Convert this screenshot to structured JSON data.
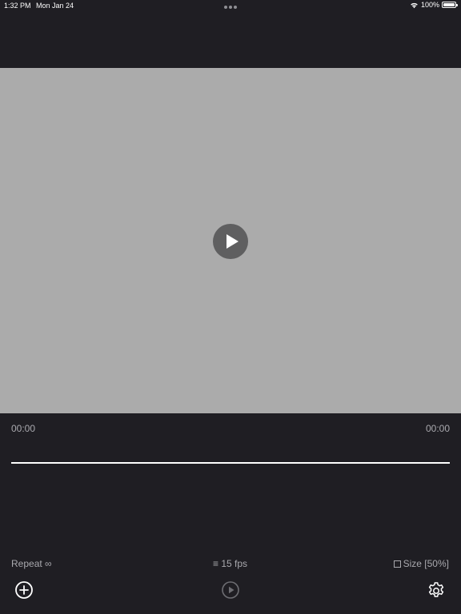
{
  "status_bar": {
    "time": "1:32 PM",
    "date": "Mon Jan 24",
    "battery": "100%",
    "icons": [
      "wifi-icon",
      "battery-icon",
      "multitask-dots-icon"
    ]
  },
  "preview": {
    "icon": "play-icon",
    "colors": {
      "canvas": "#ababab",
      "button": "#5f5f60"
    }
  },
  "timeline": {
    "start_time": "00:00",
    "end_time": "00:00"
  },
  "options": {
    "repeat": "Repeat ∞",
    "fps": "≡ 15 fps",
    "size": "Size [50%]",
    "size_checked": false
  },
  "toolbar": {
    "icons": [
      "plus-circle-icon",
      "play-circle-icon",
      "gear-icon"
    ]
  },
  "colors": {
    "background": "#1f1e23",
    "secondary_text": "#a9a9ae",
    "accent": "#ffffff"
  }
}
